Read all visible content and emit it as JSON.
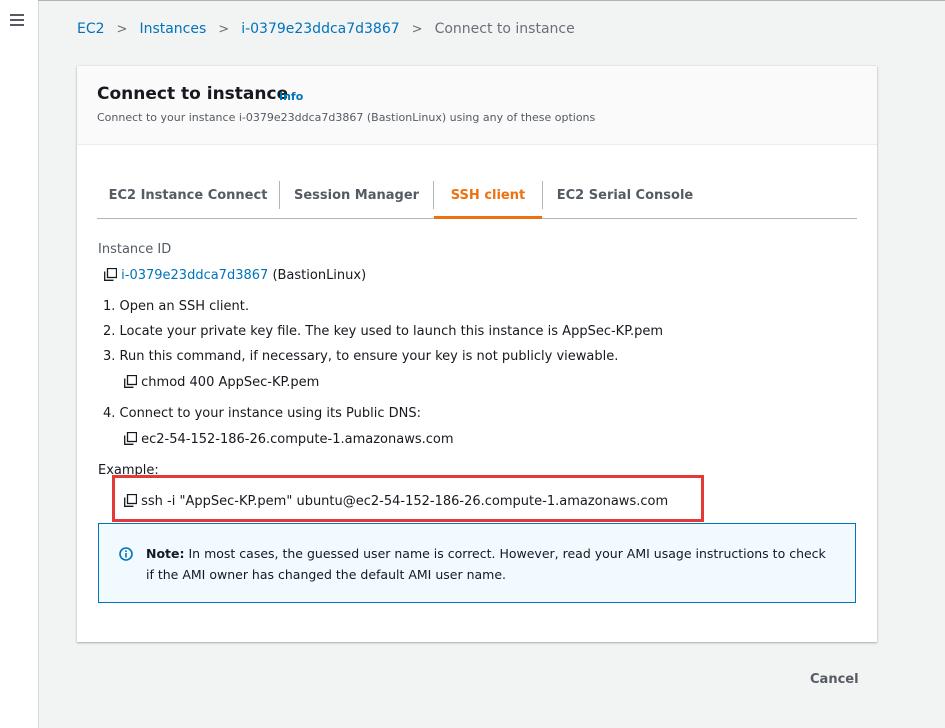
{
  "breadcrumb": {
    "items": [
      {
        "label": "EC2"
      },
      {
        "label": "Instances"
      },
      {
        "label": "i-0379e23ddca7d3867"
      }
    ],
    "current": "Connect to instance"
  },
  "panel": {
    "title": "Connect to instance",
    "info": "Info",
    "description": "Connect to your instance i-0379e23ddca7d3867 (BastionLinux) using any of these options"
  },
  "tabs": [
    {
      "label": "EC2 Instance Connect",
      "active": false
    },
    {
      "label": "Session Manager",
      "active": false
    },
    {
      "label": "SSH client",
      "active": true
    },
    {
      "label": "EC2 Serial Console",
      "active": false
    }
  ],
  "ssh": {
    "instance_id_label": "Instance ID",
    "instance_id": "i-0379e23ddca7d3867",
    "instance_name": "(BastionLinux)",
    "step1": "1. Open an SSH client.",
    "step2": "2. Locate your private key file. The key used to launch this instance is AppSec-KP.pem",
    "step3": "3. Run this command, if necessary, to ensure your key is not publicly viewable.",
    "chmod_command": "chmod 400 AppSec-KP.pem",
    "step4": "4. Connect to your instance using its Public DNS:",
    "public_dns": "ec2-54-152-186-26.compute-1.amazonaws.com",
    "example_label": "Example:",
    "example_command": "ssh -i \"AppSec-KP.pem\" ubuntu@ec2-54-152-186-26.compute-1.amazonaws.com"
  },
  "note": {
    "bold": "Note:",
    "text": " In most cases, the guessed user name is correct. However, read your AMI usage instructions to check if the AMI owner has changed the default AMI user name."
  },
  "footer": {
    "cancel_label": "Cancel"
  },
  "colors": {
    "link": "#0073bb",
    "active_tab": "#ec7211",
    "highlight": "#e53935",
    "note_bg": "#f1faff"
  },
  "icons": {
    "menu": "hamburger-icon",
    "copy": "copy-icon",
    "info": "info-circle-icon",
    "separator": "chevron-right-icon"
  }
}
